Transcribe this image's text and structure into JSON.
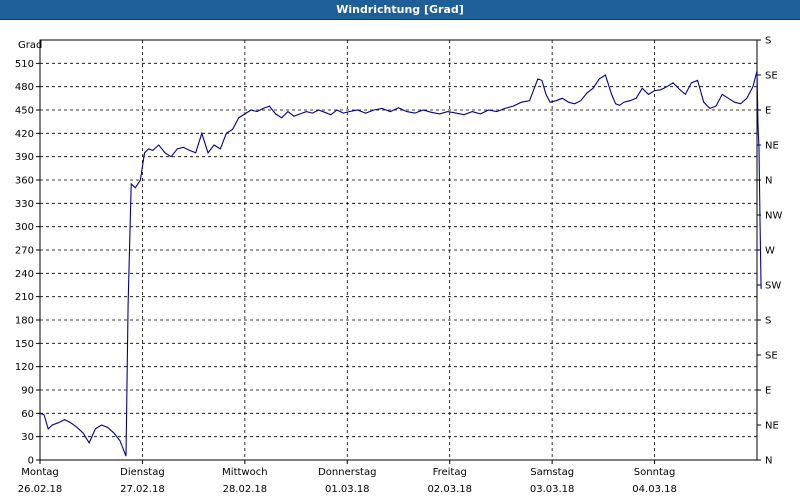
{
  "window": {
    "title": "Windrichtung [Grad]"
  },
  "chart_data": {
    "type": "line",
    "title": "Windrichtung [Grad]",
    "ylabel": "Grad",
    "ylim": [
      0,
      540
    ],
    "y_ticks": [
      0,
      30,
      60,
      90,
      120,
      150,
      180,
      210,
      240,
      270,
      300,
      330,
      360,
      390,
      420,
      450,
      480,
      510
    ],
    "right_axis_labels": [
      "N",
      "NE",
      "E",
      "SE",
      "S",
      "SW",
      "W",
      "NW",
      "N",
      "NE",
      "E",
      "SE",
      "S"
    ],
    "right_axis_values": [
      0,
      45,
      90,
      135,
      180,
      225,
      270,
      315,
      360,
      405,
      450,
      495,
      540
    ],
    "x_range": [
      0,
      7
    ],
    "x_ticks": [
      {
        "day": "Montag",
        "date": "26.02.18"
      },
      {
        "day": "Dienstag",
        "date": "27.02.18"
      },
      {
        "day": "Mittwoch",
        "date": "28.02.18"
      },
      {
        "day": "Donnerstag",
        "date": "01.03.18"
      },
      {
        "day": "Freitag",
        "date": "02.03.18"
      },
      {
        "day": "Samstag",
        "date": "03.03.18"
      },
      {
        "day": "Sonntag",
        "date": "04.03.18"
      }
    ],
    "grid": true,
    "line_color": "#0000a0",
    "series": [
      {
        "x": [
          0.0,
          0.04,
          0.08,
          0.12,
          0.18,
          0.24,
          0.3,
          0.36,
          0.42,
          0.48,
          0.54,
          0.6,
          0.66,
          0.72,
          0.78,
          0.84,
          0.86,
          0.89,
          0.93,
          0.98,
          1.02,
          1.06,
          1.1,
          1.16,
          1.22,
          1.28,
          1.34,
          1.4,
          1.46,
          1.52,
          1.58,
          1.64,
          1.7,
          1.76,
          1.82,
          1.88,
          1.94,
          2.0,
          2.06,
          2.12,
          2.18,
          2.24,
          2.3,
          2.36,
          2.42,
          2.48,
          2.54,
          2.6,
          2.66,
          2.72,
          2.78,
          2.84,
          2.9,
          2.96,
          3.02,
          3.1,
          3.18,
          3.26,
          3.34,
          3.42,
          3.5,
          3.58,
          3.66,
          3.74,
          3.82,
          3.9,
          3.98,
          4.06,
          4.14,
          4.22,
          4.3,
          4.38,
          4.46,
          4.54,
          4.62,
          4.7,
          4.78,
          4.86,
          4.9,
          4.94,
          4.98,
          5.04,
          5.1,
          5.16,
          5.22,
          5.28,
          5.34,
          5.4,
          5.46,
          5.52,
          5.58,
          5.62,
          5.66,
          5.7,
          5.76,
          5.82,
          5.88,
          5.94,
          6.0,
          6.06,
          6.12,
          6.18,
          6.24,
          6.3,
          6.36,
          6.42,
          6.48,
          6.54,
          6.6,
          6.66,
          6.72,
          6.78,
          6.84,
          6.9,
          6.96,
          7.0,
          7.0,
          7.01,
          7.02,
          7.03,
          7.04
        ],
        "y": [
          60,
          58,
          40,
          45,
          48,
          52,
          48,
          42,
          35,
          22,
          40,
          45,
          42,
          35,
          25,
          5,
          200,
          355,
          350,
          360,
          395,
          400,
          398,
          405,
          395,
          390,
          400,
          402,
          398,
          395,
          420,
          395,
          405,
          400,
          420,
          425,
          440,
          445,
          450,
          448,
          452,
          455,
          445,
          440,
          448,
          442,
          445,
          448,
          446,
          450,
          447,
          444,
          450,
          446,
          448,
          450,
          446,
          450,
          452,
          448,
          453,
          448,
          446,
          450,
          447,
          445,
          448,
          446,
          444,
          448,
          445,
          450,
          448,
          452,
          455,
          460,
          462,
          490,
          488,
          470,
          460,
          462,
          465,
          460,
          458,
          462,
          472,
          478,
          490,
          495,
          470,
          458,
          456,
          460,
          462,
          465,
          478,
          470,
          475,
          476,
          480,
          485,
          477,
          470,
          485,
          488,
          460,
          452,
          455,
          470,
          465,
          460,
          458,
          465,
          480,
          500,
          500,
          430,
          400,
          300,
          220
        ]
      }
    ]
  }
}
